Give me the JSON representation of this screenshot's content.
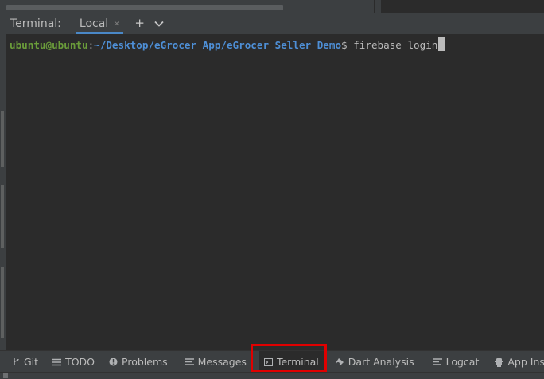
{
  "tool_window": {
    "title": "Terminal:",
    "tab_label": "Local",
    "tab_close": "×",
    "new_tab": "+",
    "dropdown": "⌄"
  },
  "terminal": {
    "user_host": "ubuntu@ubuntu",
    "colon": ":",
    "path": "~/Desktop/eGrocer App/eGrocer Seller Demo",
    "dollar": "$",
    "command": " firebase login"
  },
  "bottom_bar": {
    "items": [
      {
        "label": "Git",
        "icon": "git-branch-icon"
      },
      {
        "label": "TODO",
        "icon": "list-icon"
      },
      {
        "label": "Problems",
        "icon": "info-icon"
      },
      {
        "label": "Messages",
        "icon": "messages-icon"
      },
      {
        "label": "Terminal",
        "icon": "terminal-icon"
      },
      {
        "label": "Dart Analysis",
        "icon": "dart-analysis-icon"
      },
      {
        "label": "Logcat",
        "icon": "logcat-icon"
      },
      {
        "label": "App Inspec",
        "icon": "app-inspection-icon"
      }
    ],
    "active": "Terminal"
  },
  "colors": {
    "background": "#2b2b2b",
    "panel": "#3c3f41",
    "prompt_user": "#6a9c3a",
    "prompt_path": "#4e8fd6",
    "tab_underline": "#4a88c7",
    "highlight_box": "#e00000"
  }
}
